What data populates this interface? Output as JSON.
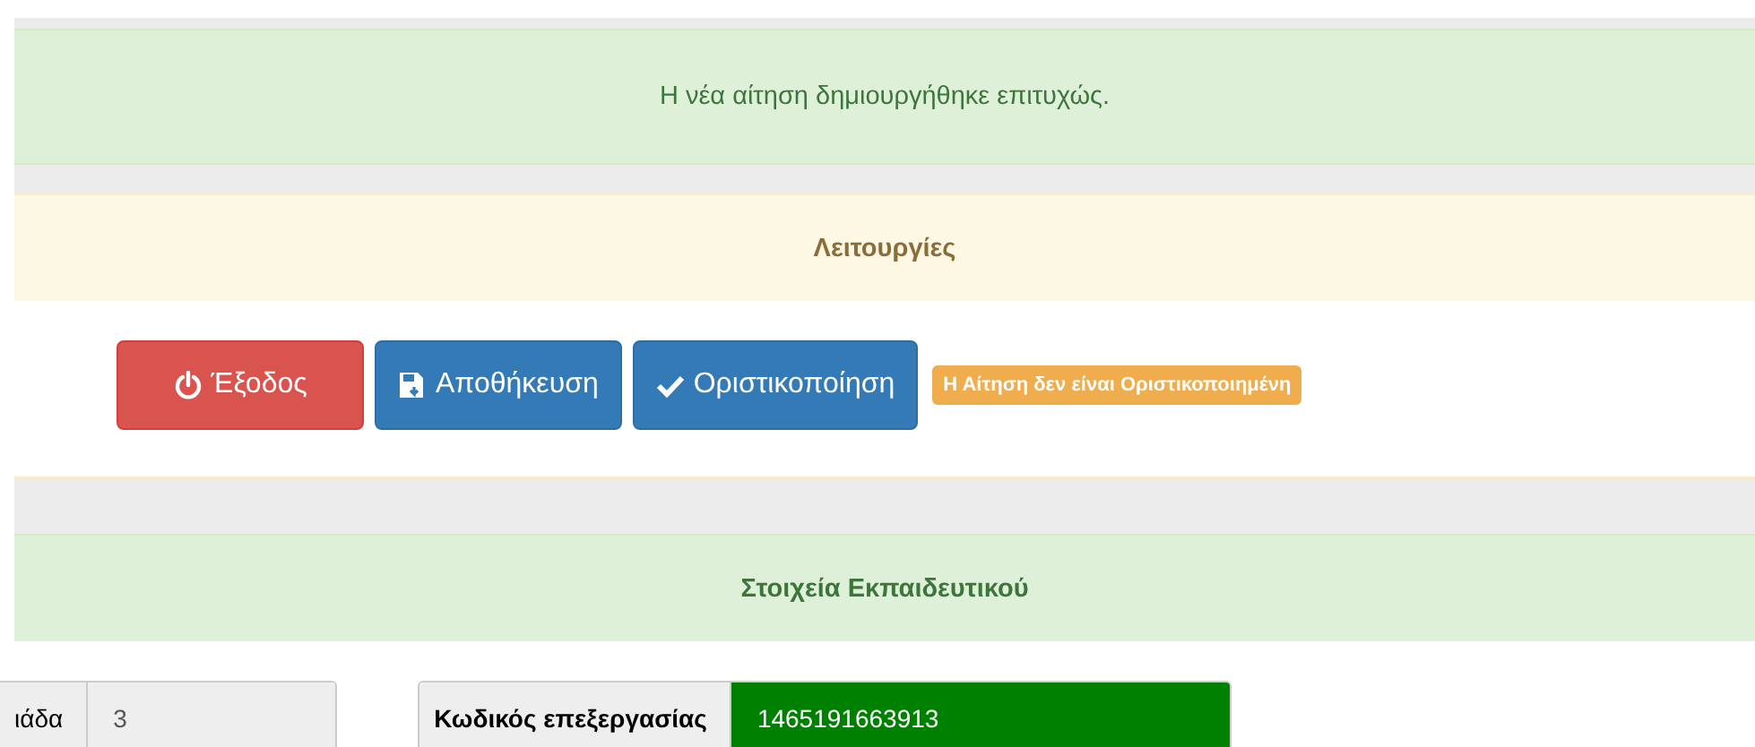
{
  "alert": {
    "message": "Η νέα αίτηση δημιουργήθηκε επιτυχώς."
  },
  "actions_panel": {
    "title": "Λειτουργίες",
    "buttons": [
      {
        "kind": "exit",
        "label": "Έξοδος"
      },
      {
        "kind": "save",
        "label": "Αποθήκευση"
      },
      {
        "kind": "finalize",
        "label": "Οριστικοποίηση"
      }
    ],
    "status_badge": "Η Αίτηση δεν είναι Οριστικοποιημένη"
  },
  "teacher_panel": {
    "title": "Στοιχεία Εκπαιδευτικού",
    "fields": [
      {
        "label": "ιάδα",
        "value": "3",
        "highlighted": false
      },
      {
        "label": "Κωδικός επεξεργασίας",
        "value": "1465191663913",
        "highlighted": true
      }
    ]
  }
}
